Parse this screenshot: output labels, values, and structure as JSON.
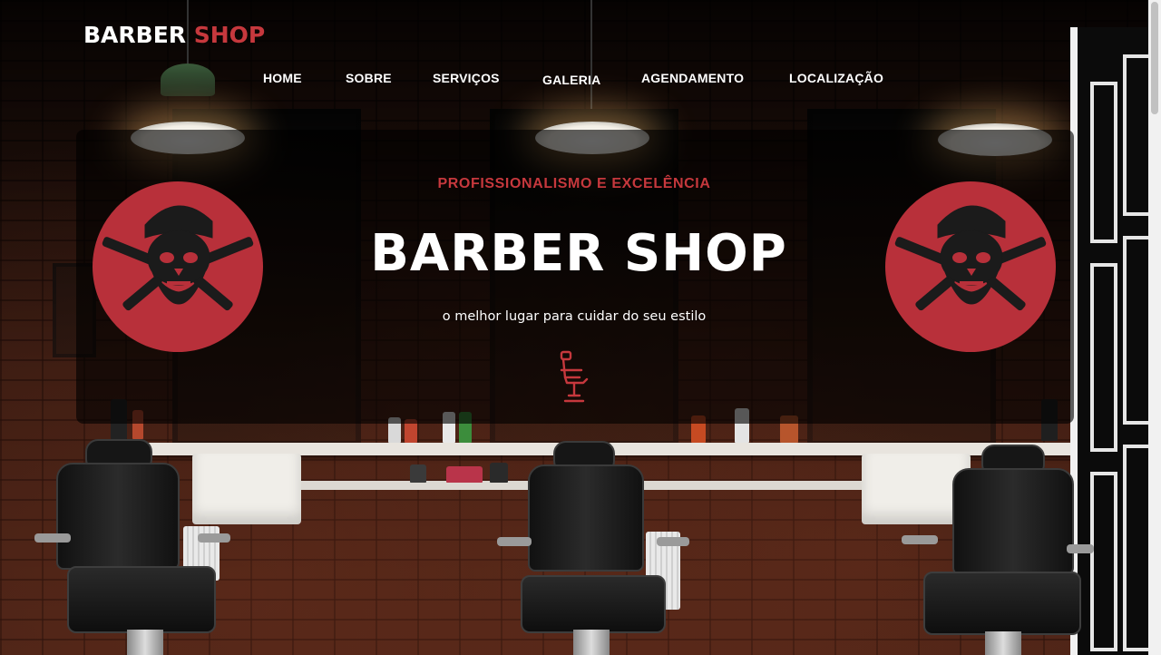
{
  "brand": {
    "part1": "BARBER ",
    "part2": "SHOP"
  },
  "nav": {
    "items": [
      "HOME",
      "SOBRE",
      "SERVIÇOS",
      "GALERIA",
      "AGENDAMENTO",
      "LOCALIZAÇÃO"
    ]
  },
  "hero": {
    "tagline": "PROFISSIONALISMO E EXCELÊNCIA",
    "title": "BARBER SHOP",
    "subtitle": "o melhor lugar para cuidar do seu estilo"
  },
  "icons": {
    "hero": "barber-chair-icon",
    "emblems": "skull-razor-emblem"
  },
  "colors": {
    "accent": "#c6383d",
    "emblem_bg": "#b8303a",
    "text": "#ffffff"
  }
}
